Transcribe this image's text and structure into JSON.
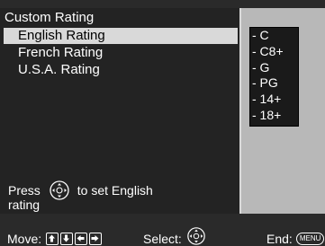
{
  "menu": {
    "title": "Custom Rating",
    "items": [
      {
        "label": "English Rating",
        "selected": true
      },
      {
        "label": "French Rating",
        "selected": false
      },
      {
        "label": "U.S.A. Rating",
        "selected": false
      }
    ]
  },
  "ratings": [
    "- C",
    "- C8+",
    "- G",
    "- PG",
    "- 14+",
    "- 18+"
  ],
  "hint": {
    "press": "Press",
    "action": "to set English",
    "line2": "rating"
  },
  "bottom": {
    "move": "Move:",
    "select": "Select:",
    "end": "End:",
    "menu_key": "MENU"
  },
  "colors": {
    "panel_bg": "#232323",
    "selected_bg": "#d9d9d9",
    "right_panel_bg": "#b8b8b8"
  }
}
